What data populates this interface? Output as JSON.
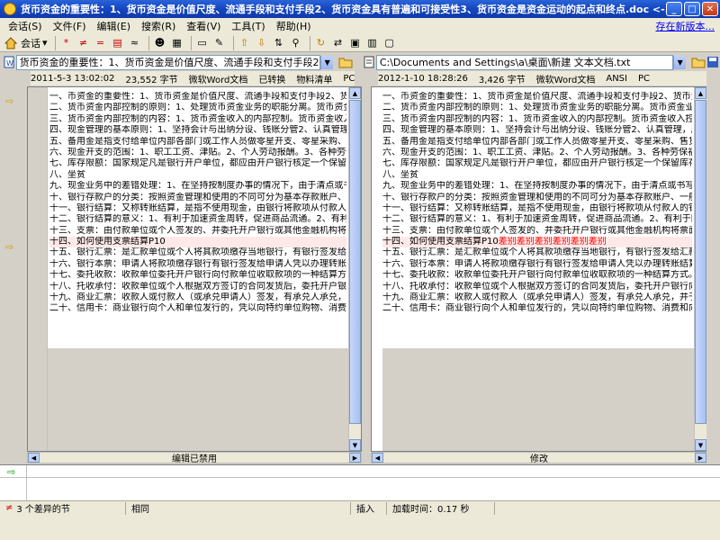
{
  "window": {
    "title": "货币资金的重要性：1、货币资金是价值尺度、流通手段和支付手段2、货币资金具有普遍和可接受性3、货币资金是资金运动的起点和终点.doc <-..."
  },
  "menu": {
    "items": [
      "会话(S)",
      "文件(F)",
      "编辑(E)",
      "搜索(R)",
      "查看(V)",
      "工具(T)",
      "帮助(H)"
    ],
    "new_version_link": "存在新版本..."
  },
  "toolbar": {
    "session_label": "会话"
  },
  "left": {
    "path": "货币资金的重要性：1、货币资金是价值尺度、流通手段和支付手段2、货币资",
    "info": [
      "2011-5-3 13:02:02",
      "23,552 字节",
      "微软Word文档",
      "已转换",
      "物料清单",
      "PC"
    ],
    "footer_label": "编辑已禁用",
    "lines": [
      "一、币资金的重要性：1、货币资金是价值尺度、流通手段和支付手段2、货币资金具",
      "二、货币资金内部控制的原则：1、处理货币资金业务的职能分离。货币资金业务包",
      "三、货币资金内部控制的内容：1、货币资金收入的内部控制。货币资金收入控制的",
      "四、现金管理的基本原则：1、坚持会计与出纳分设、钱账分管2、认真管理，严格",
      "五、备用金是指支付给单位内部各部门或工作人员做零星开支、零星采购、售货找零",
      "六、现金开支的范围：1、职工工资、津贴。2、个人劳动报酬。3、各种劳保福利支",
      "七、库存限额：国家规定凡是银行开户单位，都应由开户银行核定一个保留库存现金",
      "八、坐贫",
      "九、现金业务中的差错处理：1、在坚持按制度办事的情况下，由于清点或书写、计",
      "十、银行存款户的分类：按照资金管理和使用的不同可分为基本存款账户、一般存款",
      "十一、银行结算：又称转账结算，是指不使用现金，由银行将款项从付款人的银行存",
      "十二、银行结算的意义：1、有利于加速资金周转，促进商品流通。2、有利于国家资",
      "十三、支票：由付款单位或个人签发的、并委托开户银行或其他金融机构将票面金额",
      "十四、如何使用支票结算P10",
      "十五、银行汇票：是汇款单位或个人将其款项缴存当地银行，有银行签发给汇款人持",
      "十六、银行本票：申请人将款项缴存银行有银行签发给申请人凭以办理转账结算或支",
      "十七、委托收款：收款单位委托开户银行向付款单位收取款项的一种结算方式。",
      "十八、托收承付：收款单位或个人根据双方签订的合同发货后，委托开户银行向付款",
      "十九、商业汇票：收款人或付款人（或承兑申请人）签发，有承兑人承兑，并于到期",
      "二十、信用卡：商业银行向个人和单位发行的，凭以向特约单位购物、消费和向银行"
    ]
  },
  "right": {
    "path": "C:\\Documents and Settings\\a\\桌面\\新建 文本文档.txt",
    "info": [
      "2012-1-10 18:28:26",
      "3,426 字节",
      "微软Word文档",
      "ANSI",
      "PC"
    ],
    "footer_label": "修改",
    "lines": [
      "一、币资金的重要性：1、货币资金是价值尺度、流通手段和支付手段2、货币资金具",
      "二、货币资金内部控制的原则：1、处理货币资金业务的职能分离。货币资金业务包",
      "三、货币资金内部控制的内容：1、货币资金收入的内部控制。货币资金收入控制的",
      "四、现金管理的基本原则：1、坚持会计与出纳分设、钱账分管2、认真管理，严格",
      "五、备用金是指支付给单位内部各部门或工作人员做零星开支、零星采购、售货找零",
      "六、现金开支的范围：1、职工工资、津贴。2、个人劳动报酬。3、各种劳保福利支",
      "七、库存限额：国家规定凡是银行开户单位，都应由开户银行核定一个保留库存现金",
      "八、坐贫",
      "九、现金业务中的差错处理：1、在坚持按制度办事的情况下，由于清点或书写、计",
      "十、银行存款户的分类：按照资金管理和使用的不同可分为基本存款账户、一般存款",
      "十一、银行结算：又称转账结算，是指不使用现金，由银行将款项从付款人的银行存",
      "十二、银行结算的意义：1、有利于加速资金周转，促进商品流通。2、有利于国家资",
      "十三、支票：由付款单位或个人签发的、并委托开户银行或其他金融机构将票面金额",
      "十四、如何使用支票结算P10",
      "十五、银行汇票：是汇款单位或个人将其款项缴存当地银行，有银行签发给汇款人持",
      "十六、银行本票：申请人将款项缴存银行有银行签发给申请人凭以办理转账结算或支",
      "十七、委托收款：收款单位委托开户银行向付款单位收取款项的一种结算方式。",
      "十八、托收承付：收款单位或个人根据双方签订的合同发货后，委托开户银行向付款",
      "十九、商业汇票：收款人或付款人（或承兑申请人）签发，有承兑人承兑，并于到期",
      "二十、信用卡：商业银行向个人和单位发行的，凭以向特约单位购物、消费和向银行"
    ],
    "diff_insert": "差别差别差别差别差别差别"
  },
  "status": {
    "diff_count": "3 个差异的节",
    "same": "相同",
    "mode": "插入",
    "load_time": "加载时间：0.17 秒"
  }
}
